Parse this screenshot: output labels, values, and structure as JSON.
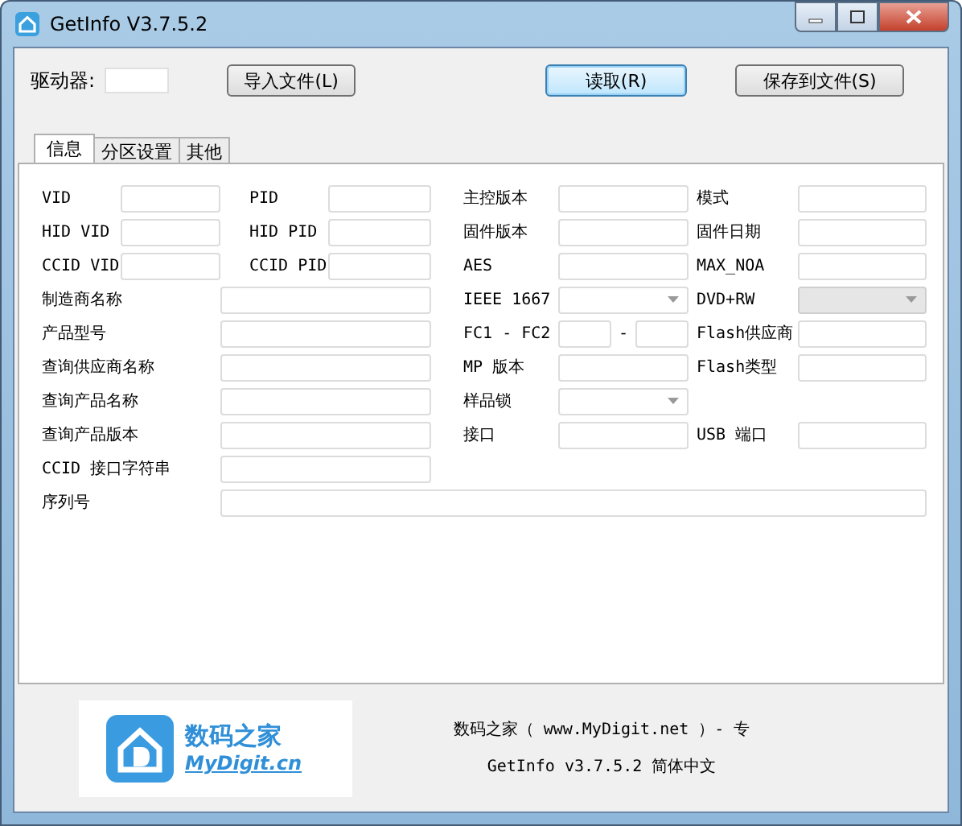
{
  "window": {
    "title": "GetInfo V3.7.5.2"
  },
  "toolbar": {
    "drive_label": "驱动器:",
    "buttons": [
      {
        "label": "导入文件(L)",
        "focused": false
      },
      {
        "label": "读取(R)",
        "focused": true
      },
      {
        "label": "保存到文件(S)",
        "focused": false
      }
    ]
  },
  "tabs": [
    {
      "label": "信息",
      "selected": true
    },
    {
      "label": "分区设置",
      "selected": false
    },
    {
      "label": "其他",
      "selected": false
    }
  ],
  "rows": [
    {
      "left": [
        {
          "label": "VID",
          "kind": "text",
          "disabled": false
        },
        {
          "label": "PID",
          "kind": "text",
          "disabled": false
        }
      ],
      "right": [
        {
          "label": "主控版本",
          "kind": "text",
          "disabled": false
        },
        {
          "label": "模式",
          "kind": "text",
          "disabled": false
        }
      ]
    },
    {
      "left": [
        {
          "label": "HID VID",
          "kind": "text",
          "disabled": false
        },
        {
          "label": "HID PID",
          "kind": "text",
          "disabled": false
        }
      ],
      "right": [
        {
          "label": "固件版本",
          "kind": "text",
          "disabled": false
        },
        {
          "label": "固件日期",
          "kind": "text",
          "disabled": false
        }
      ]
    },
    {
      "left": [
        {
          "label": "CCID VID",
          "kind": "text",
          "disabled": false
        },
        {
          "label": "CCID PID",
          "kind": "text",
          "disabled": false
        }
      ],
      "right": [
        {
          "label": "AES",
          "kind": "text",
          "disabled": false
        },
        {
          "label": "MAX_NOA",
          "kind": "text",
          "disabled": false
        }
      ]
    },
    {
      "left": [
        {
          "label": "制造商名称",
          "kind": "wide",
          "disabled": false
        }
      ],
      "right": [
        {
          "label": "IEEE 1667",
          "kind": "combo",
          "disabled": false
        },
        {
          "label": "DVD+RW",
          "kind": "combo",
          "disabled": true
        }
      ]
    },
    {
      "left": [
        {
          "label": "产品型号",
          "kind": "wide",
          "disabled": false
        }
      ],
      "right": [
        {
          "label": "FC1 - FC2",
          "kind": "range",
          "separator": "-",
          "disabled": false
        },
        {
          "label": "Flash供应商",
          "kind": "text",
          "disabled": false
        }
      ]
    },
    {
      "left": [
        {
          "label": "查询供应商名称",
          "kind": "wide",
          "disabled": false
        }
      ],
      "right": [
        {
          "label": "MP 版本",
          "kind": "text",
          "disabled": false
        },
        {
          "label": "Flash类型",
          "kind": "text",
          "disabled": false
        }
      ]
    },
    {
      "left": [
        {
          "label": "查询产品名称",
          "kind": "wide",
          "disabled": false
        }
      ],
      "right": [
        {
          "label": "样品锁",
          "kind": "combo",
          "disabled": false
        }
      ]
    },
    {
      "left": [
        {
          "label": "查询产品版本",
          "kind": "wide",
          "disabled": false
        }
      ],
      "right": [
        {
          "label": "接口",
          "kind": "text",
          "disabled": false
        },
        {
          "label": "USB 端口",
          "kind": "text",
          "disabled": false
        }
      ]
    },
    {
      "left": [
        {
          "label": "CCID 接口字符串",
          "kind": "wide",
          "disabled": false
        }
      ],
      "right": []
    },
    {
      "left": [
        {
          "label": "序列号",
          "kind": "full",
          "disabled": false
        }
      ],
      "right": []
    }
  ],
  "footer": {
    "logo_name": "数码之家",
    "logo_url": "MyDigit.cn",
    "lines": [
      "数码之家（ www.MyDigit.net ）- 专",
      "GetInfo v3.7.5.2 简体中文"
    ]
  }
}
